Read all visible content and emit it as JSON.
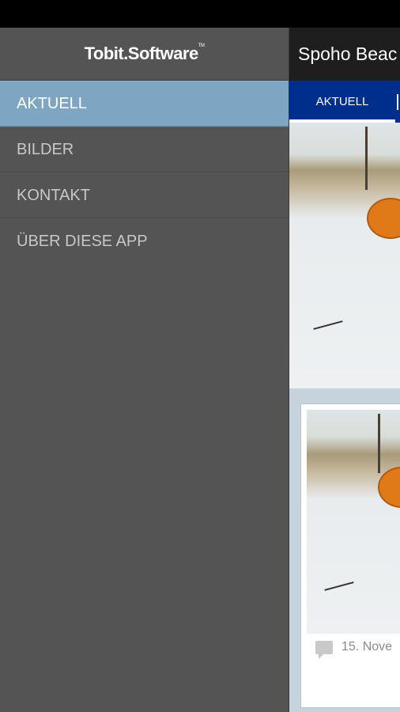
{
  "drawer": {
    "logo": "Tobit.Software",
    "logo_tm": "TM",
    "items": [
      {
        "label": "AKTUELL",
        "active": true
      },
      {
        "label": "BILDER",
        "active": false
      },
      {
        "label": "KONTAKT",
        "active": false
      },
      {
        "label": "ÜBER DIESE APP",
        "active": false
      }
    ]
  },
  "content": {
    "title": "Spoho Beac",
    "tabs": [
      {
        "label": "AKTUELL"
      }
    ],
    "card": {
      "date": "15. Nove"
    }
  },
  "colors": {
    "drawer_bg": "#545454",
    "active_item": "#7ea6c2",
    "tab_bar": "#002e8c"
  }
}
